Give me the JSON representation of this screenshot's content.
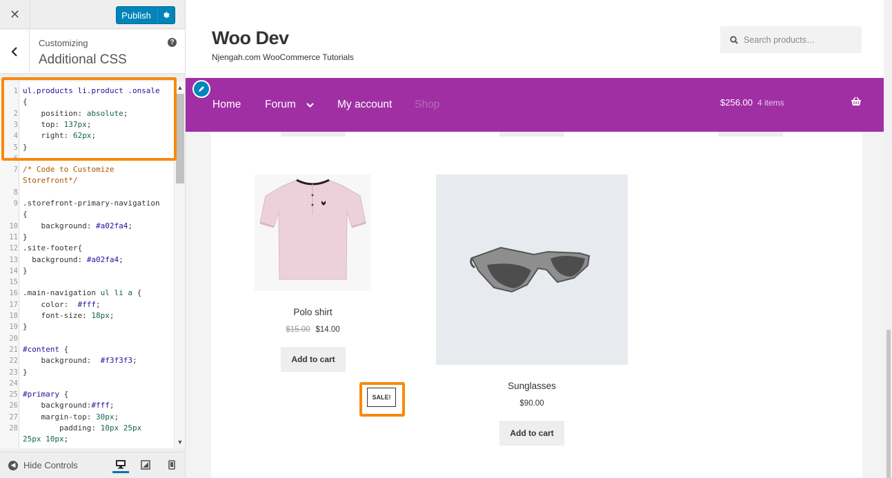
{
  "customizer": {
    "close_icon": "close-icon",
    "publish_label": "Publish",
    "section_label": "Customizing",
    "section_title": "Additional CSS",
    "hide_controls_label": "Hide Controls",
    "code_lines": [
      {
        "n": "1",
        "parts": [
          [
            "k",
            "ul.products li.product .onsale"
          ]
        ]
      },
      {
        "n": "",
        "parts": [
          [
            "",
            "{"
          ]
        ]
      },
      {
        "n": "2",
        "parts": [
          [
            "",
            "    position: "
          ],
          [
            "v",
            "absolute"
          ],
          [
            "",
            ";"
          ]
        ]
      },
      {
        "n": "3",
        "parts": [
          [
            "",
            "    top: "
          ],
          [
            "n",
            "137px"
          ],
          [
            "",
            ";"
          ]
        ]
      },
      {
        "n": "4",
        "parts": [
          [
            "",
            "    right: "
          ],
          [
            "n",
            "62px"
          ],
          [
            "",
            ";"
          ]
        ]
      },
      {
        "n": "5",
        "parts": [
          [
            "",
            "}"
          ]
        ]
      },
      {
        "n": "6",
        "parts": [
          [
            "",
            ""
          ]
        ]
      },
      {
        "n": "7",
        "parts": [
          [
            "c",
            "/* Code to Customize"
          ]
        ]
      },
      {
        "n": "",
        "parts": [
          [
            "c",
            "Storefront*/"
          ]
        ]
      },
      {
        "n": "8",
        "parts": [
          [
            "",
            ""
          ]
        ]
      },
      {
        "n": "9",
        "parts": [
          [
            "",
            ".storefront-primary-navigation"
          ]
        ]
      },
      {
        "n": "",
        "parts": [
          [
            "",
            "{"
          ]
        ]
      },
      {
        "n": "10",
        "parts": [
          [
            "",
            "    background: "
          ],
          [
            "k",
            "#a02fa4"
          ],
          [
            "",
            ";"
          ]
        ]
      },
      {
        "n": "11",
        "parts": [
          [
            "",
            "}"
          ]
        ]
      },
      {
        "n": "12",
        "parts": [
          [
            "",
            ".site-footer{"
          ]
        ]
      },
      {
        "n": "13",
        "parts": [
          [
            "",
            "  background: "
          ],
          [
            "k",
            "#a02fa4"
          ],
          [
            "",
            ";"
          ]
        ]
      },
      {
        "n": "14",
        "parts": [
          [
            "",
            "}"
          ]
        ]
      },
      {
        "n": "15",
        "parts": [
          [
            "",
            ""
          ]
        ]
      },
      {
        "n": "16",
        "parts": [
          [
            "",
            ".main-navigation "
          ],
          [
            "v",
            "ul li a"
          ],
          [
            "",
            " {"
          ]
        ]
      },
      {
        "n": "17",
        "parts": [
          [
            "",
            "    color:  "
          ],
          [
            "k",
            "#fff"
          ],
          [
            "",
            ";"
          ]
        ]
      },
      {
        "n": "18",
        "parts": [
          [
            "",
            "    font-size: "
          ],
          [
            "n",
            "18px"
          ],
          [
            "",
            ";"
          ]
        ]
      },
      {
        "n": "19",
        "parts": [
          [
            "",
            "}"
          ]
        ]
      },
      {
        "n": "20",
        "parts": [
          [
            "",
            ""
          ]
        ]
      },
      {
        "n": "21",
        "parts": [
          [
            "k",
            "#content"
          ],
          [
            "",
            " {"
          ]
        ]
      },
      {
        "n": "22",
        "parts": [
          [
            "",
            "    background:  "
          ],
          [
            "k",
            "#f3f3f3"
          ],
          [
            "",
            ";"
          ]
        ]
      },
      {
        "n": "23",
        "parts": [
          [
            "",
            "}"
          ]
        ]
      },
      {
        "n": "24",
        "parts": [
          [
            "",
            ""
          ]
        ]
      },
      {
        "n": "25",
        "parts": [
          [
            "k",
            "#primary"
          ],
          [
            "",
            " {"
          ]
        ]
      },
      {
        "n": "26",
        "parts": [
          [
            "",
            "    background:"
          ],
          [
            "k",
            "#fff"
          ],
          [
            "",
            ";"
          ]
        ]
      },
      {
        "n": "27",
        "parts": [
          [
            "",
            "    margin-top: "
          ],
          [
            "n",
            "30px"
          ],
          [
            "",
            ";"
          ]
        ]
      },
      {
        "n": "28",
        "parts": [
          [
            "",
            "        padding: "
          ],
          [
            "n",
            "10px 25px"
          ]
        ]
      },
      {
        "n": "",
        "parts": [
          [
            "n",
            "25px 10px"
          ],
          [
            "",
            ";"
          ]
        ]
      }
    ]
  },
  "site": {
    "title": "Woo Dev",
    "description": "Njengah.com WooCommerce Tutorials",
    "search_placeholder": "Search products…",
    "nav": [
      "Home",
      "Forum",
      "My account",
      "Shop"
    ],
    "cart_total": "$256.00",
    "cart_count": "4 items"
  },
  "products": [
    {
      "name": "Polo shirt",
      "old_price": "$15.00",
      "price": "$14.00",
      "sale_label": "SALE!",
      "button": "Add to cart"
    },
    {
      "name": "Sunglasses",
      "price": "$90.00",
      "button": "Add to cart"
    }
  ],
  "colors": {
    "nav_bg": "#a02fa4",
    "publish_bg": "#0085ba",
    "highlight": "#f7890c",
    "content_bg": "#f3f3f3"
  }
}
